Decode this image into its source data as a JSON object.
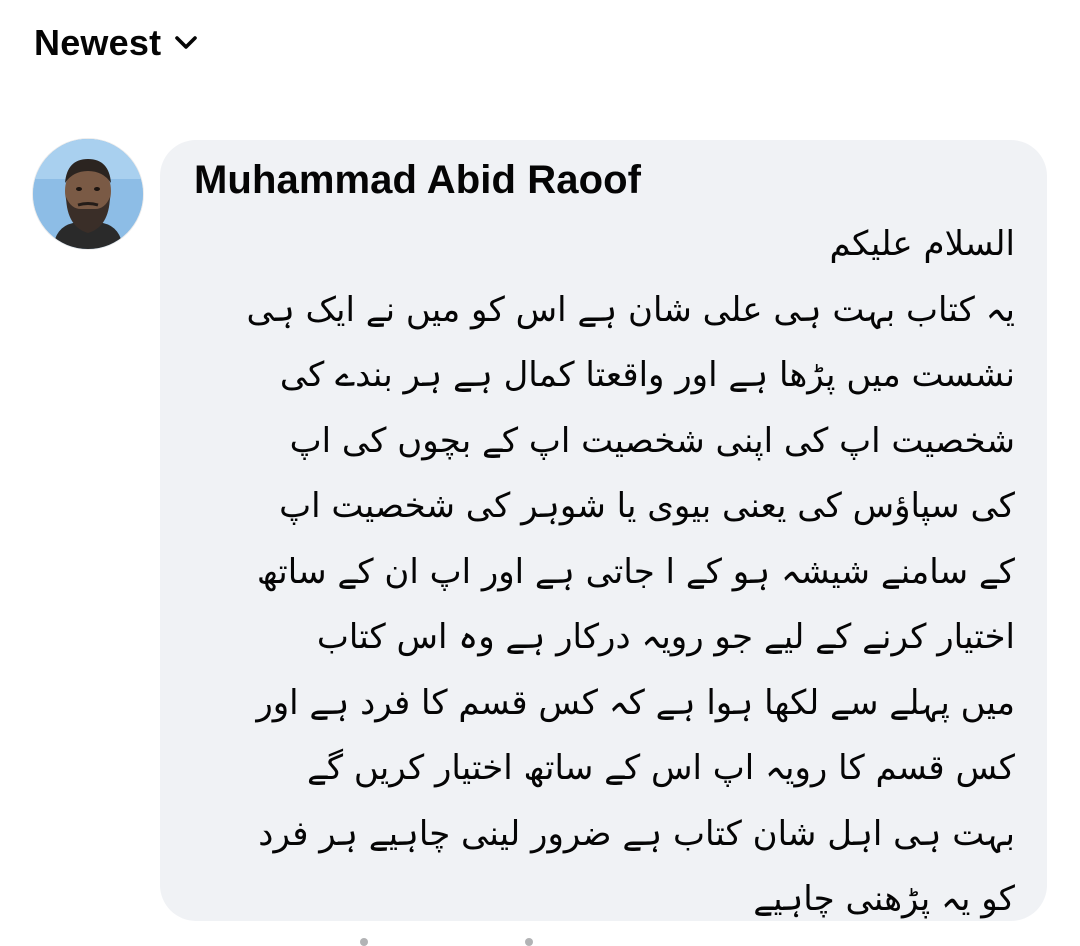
{
  "sort": {
    "label": "Newest",
    "icon": "chevron-down-icon"
  },
  "comment": {
    "author": "Muhammad Abid Raoof",
    "avatar_icon": "avatar",
    "lines": [
      "السلام علیکم",
      "یہ کتاب بہت ہی علی شان ہے اس کو میں نے ایک ہی",
      "نشست میں پڑھا ہے اور واقعتا کمال ہے ہر بندے کی",
      "شخصیت اپ کی اپنی شخصیت اپ کے بچوں کی اپ",
      "کی سپاؤس کی یعنی بیوی یا شوہر کی شخصیت اپ",
      "کے سامنے شیشہ ہو کے ا جاتی ہے اور اپ ان کے ساتھ",
      "اختیار کرنے کے لیے جو رویہ درکار ہے وہ اس کتاب",
      "میں پہلے سے لکھا ہوا ہے کہ کس قسم کا فرد ہے اور",
      "کس قسم کا رویہ اپ اس کے ساتھ اختیار کریں گے",
      "بہت ہی اہل شان کتاب ہے ضرور لینی چاہیے ہر فرد",
      "کو یہ پڑھنی چاہیے"
    ]
  },
  "colors": {
    "bubble_bg": "#f0f2f5",
    "text": "#050505",
    "avatar_bg": "#9fc6e8"
  }
}
